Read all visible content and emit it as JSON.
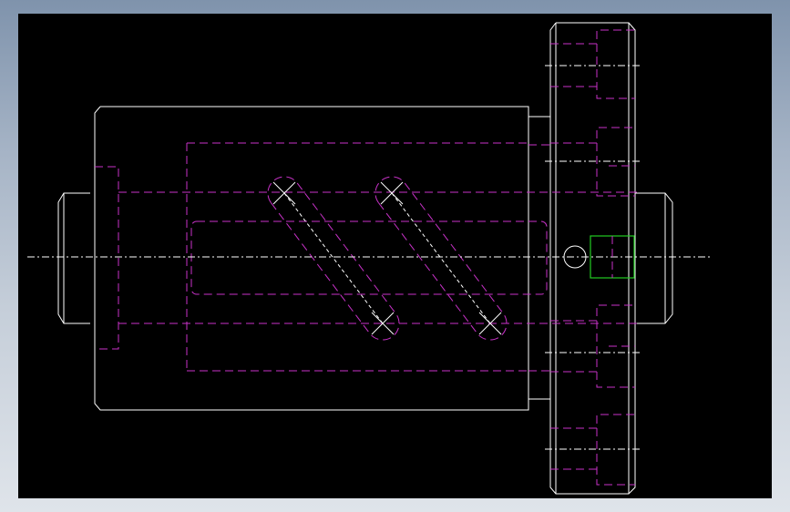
{
  "drawing": {
    "background": "#000000",
    "frame_color": "#7f93ac",
    "colors": {
      "visible_edge": "#ffffff",
      "hidden_line": "#c832c8",
      "center_line": "#ffffff",
      "highlight": "#22cc22"
    },
    "icons": {
      "hidden-line": "dashed-magenta-stroke",
      "center-line": "dash-dot-white-stroke"
    }
  }
}
